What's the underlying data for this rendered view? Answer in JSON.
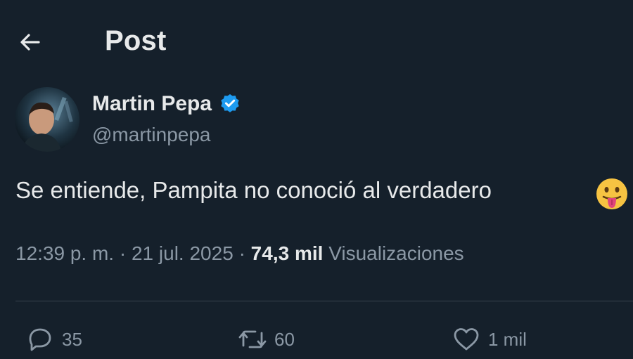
{
  "header": {
    "title": "Post"
  },
  "author": {
    "display_name": "Martin Pepa",
    "handle": "@martinpepa",
    "verified": true
  },
  "post": {
    "text": "Se entiende, Pampita no conoció al verdadero",
    "emoji": "face-with-tongue",
    "time": "12:39 p. m.",
    "date": "21 jul. 2025",
    "views_count": "74,3 mil",
    "views_label": "Visualizaciones",
    "separator": "·"
  },
  "actions": {
    "replies": "35",
    "reposts": "60",
    "likes": "1 mil"
  },
  "colors": {
    "background": "#15202b",
    "text_primary": "#e7e9ea",
    "text_secondary": "#8b98a5",
    "verified_blue": "#1d9bf0",
    "divider": "#38444d"
  }
}
